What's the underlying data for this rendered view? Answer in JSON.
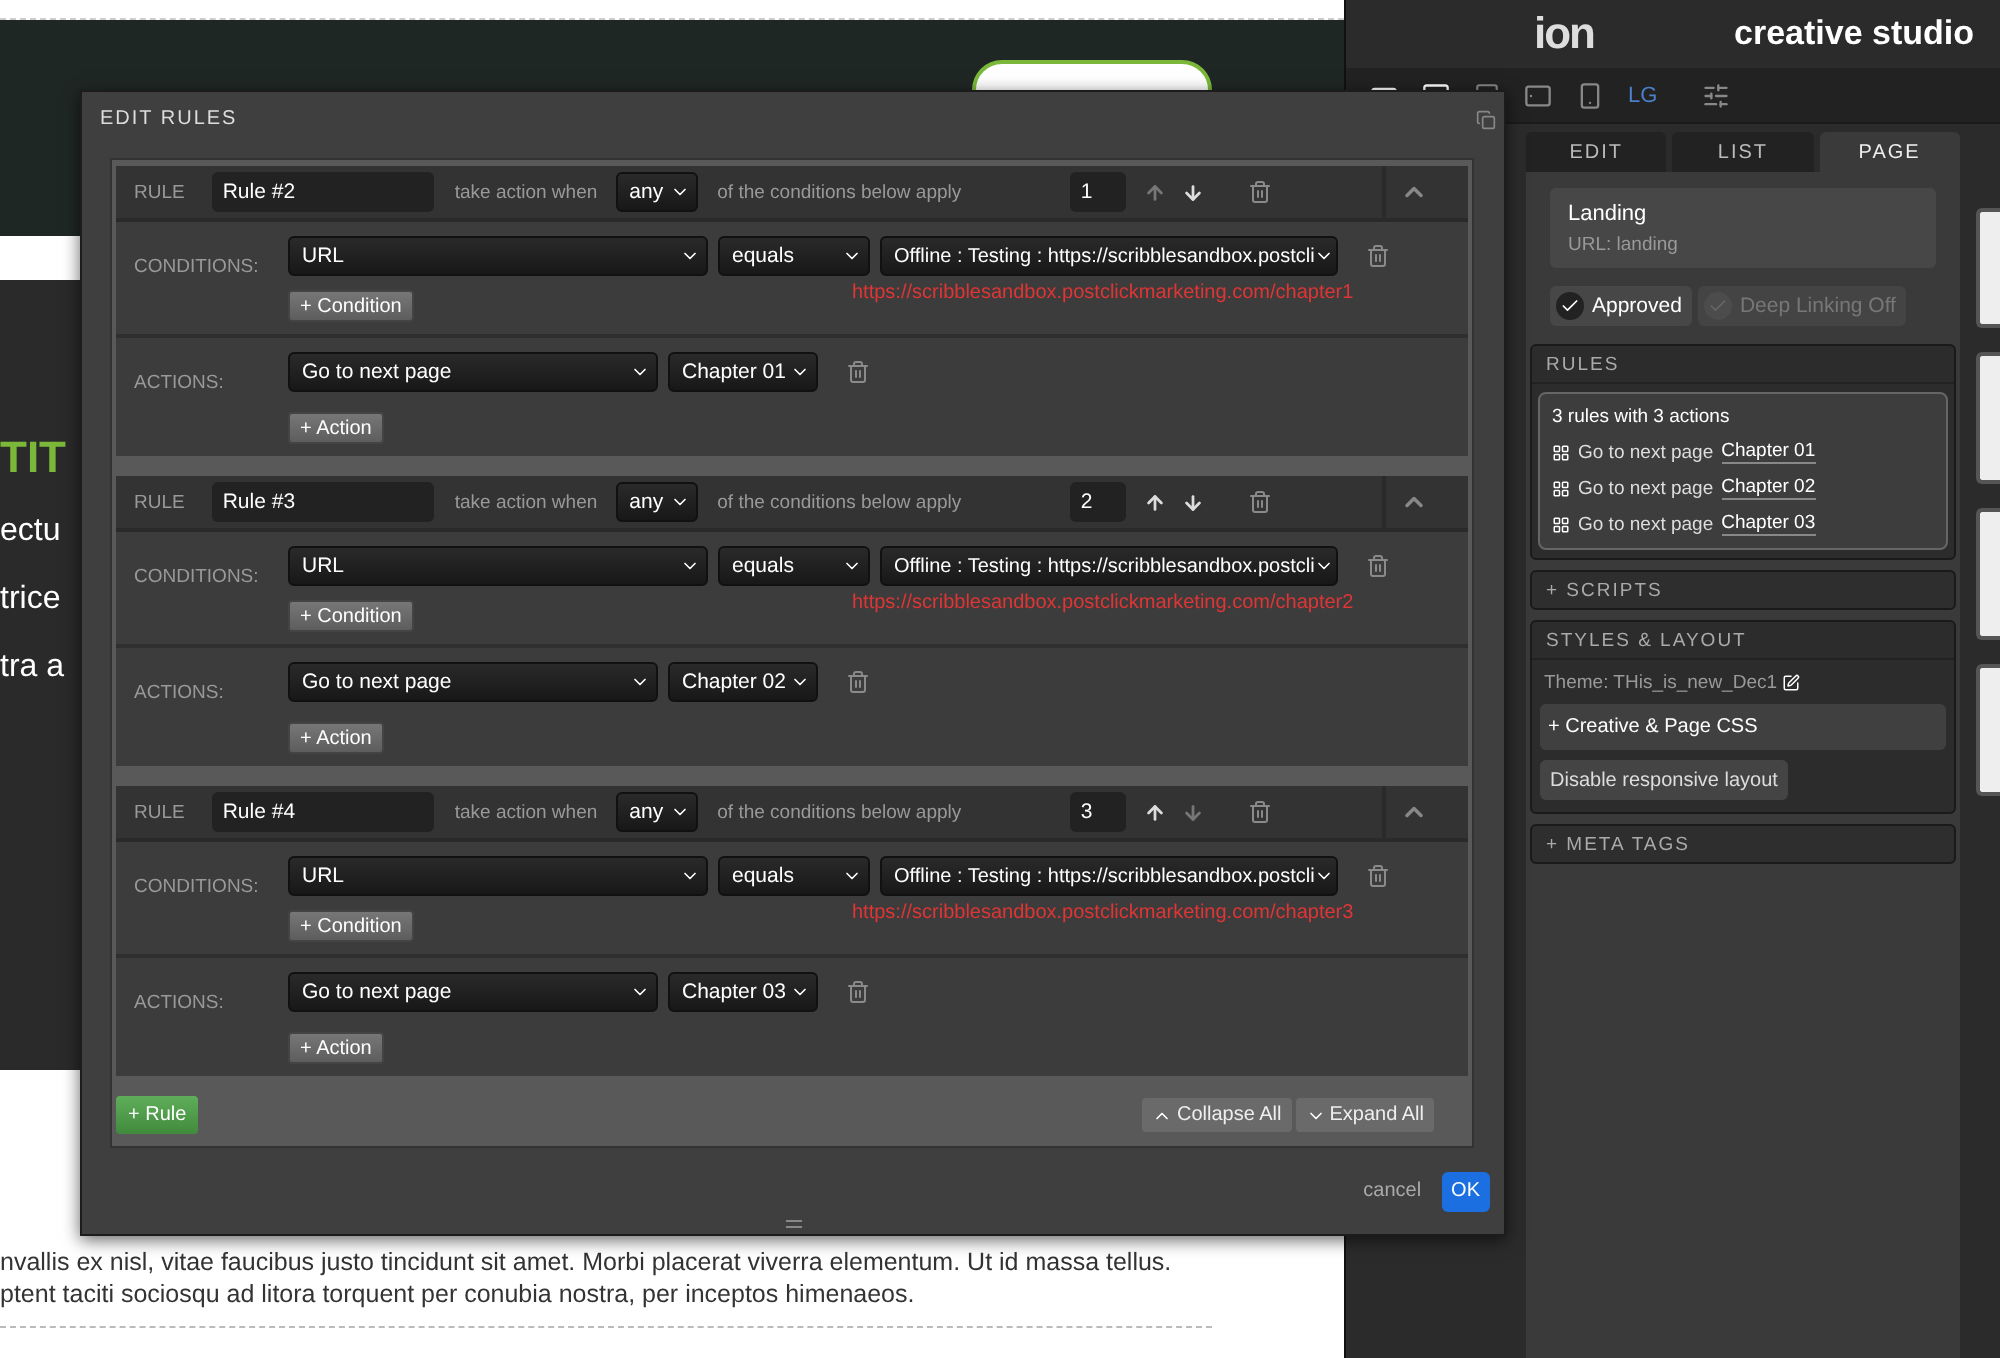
{
  "background_page": {
    "heading_fragment": "TIT",
    "text_fragments": [
      "ectu",
      "trice",
      "tra a"
    ],
    "paragraph_lines": [
      "nvallis ex nisl, vitae faucibus justo tincidunt sit amet. Morbi placerat viverra elementum. Ut id massa tellus.",
      "ptent taciti sociosqu ad litora torquent per conubia nostra, per inceptos himenaeos."
    ]
  },
  "studio": {
    "logo": "ion",
    "title": "creative studio",
    "size_label": "LG",
    "tabs": [
      {
        "label": "EDIT",
        "selected": false
      },
      {
        "label": "LIST",
        "selected": false
      },
      {
        "label": "PAGE",
        "selected": true
      }
    ],
    "page_card": {
      "name": "Landing",
      "url": "URL: landing"
    },
    "toggles": [
      {
        "label": "Approved",
        "on": true
      },
      {
        "label": "Deep Linking Off",
        "on": false
      }
    ],
    "rules_section": {
      "title": "RULES",
      "summary": "3 rules with 3 actions",
      "items": [
        {
          "text": "Go to next page",
          "link": "Chapter 01"
        },
        {
          "text": "Go to next page",
          "link": "Chapter 02"
        },
        {
          "text": "Go to next page",
          "link": "Chapter 03"
        }
      ]
    },
    "scripts": "+ SCRIPTS",
    "styles": {
      "title": "STYLES & LAYOUT",
      "theme": "Theme: THis_is_new_Dec1",
      "css_button": "+ Creative & Page CSS",
      "responsive_button": "Disable responsive layout"
    },
    "meta_tags": "+ META TAGS"
  },
  "dialog": {
    "title": "EDIT RULES",
    "rules": [
      {
        "label": "RULE",
        "name": "Rule #2",
        "pre": "take action when",
        "match": "any",
        "post": "of the conditions below apply",
        "order": "1",
        "can_move_up": false,
        "can_move_down": true,
        "conditions_label": "CONDITIONS:",
        "conditions": [
          {
            "field": "URL",
            "operator": "equals",
            "value": "Offline : Testing : https://scribblesandbox.postcli",
            "hint": "https://scribblesandbox.postclickmarketing.com/chapter1"
          }
        ],
        "add_condition": "+ Condition",
        "actions_label": "ACTIONS:",
        "actions": [
          {
            "action": "Go to next page",
            "target": "Chapter 01"
          }
        ],
        "add_action": "+ Action"
      },
      {
        "label": "RULE",
        "name": "Rule #3",
        "pre": "take action when",
        "match": "any",
        "post": "of the conditions below apply",
        "order": "2",
        "can_move_up": true,
        "can_move_down": true,
        "conditions_label": "CONDITIONS:",
        "conditions": [
          {
            "field": "URL",
            "operator": "equals",
            "value": "Offline : Testing : https://scribblesandbox.postcli",
            "hint": "https://scribblesandbox.postclickmarketing.com/chapter2"
          }
        ],
        "add_condition": "+ Condition",
        "actions_label": "ACTIONS:",
        "actions": [
          {
            "action": "Go to next page",
            "target": "Chapter 02"
          }
        ],
        "add_action": "+ Action"
      },
      {
        "label": "RULE",
        "name": "Rule #4",
        "pre": "take action when",
        "match": "any",
        "post": "of the conditions below apply",
        "order": "3",
        "can_move_up": true,
        "can_move_down": false,
        "conditions_label": "CONDITIONS:",
        "conditions": [
          {
            "field": "URL",
            "operator": "equals",
            "value": "Offline : Testing : https://scribblesandbox.postcli",
            "hint": "https://scribblesandbox.postclickmarketing.com/chapter3"
          }
        ],
        "add_condition": "+ Condition",
        "actions_label": "ACTIONS:",
        "actions": [
          {
            "action": "Go to next page",
            "target": "Chapter 03"
          }
        ],
        "add_action": "+ Action"
      }
    ],
    "add_rule": "+ Rule",
    "collapse_all": "Collapse All",
    "expand_all": "Expand All",
    "cancel": "cancel",
    "ok": "OK"
  }
}
